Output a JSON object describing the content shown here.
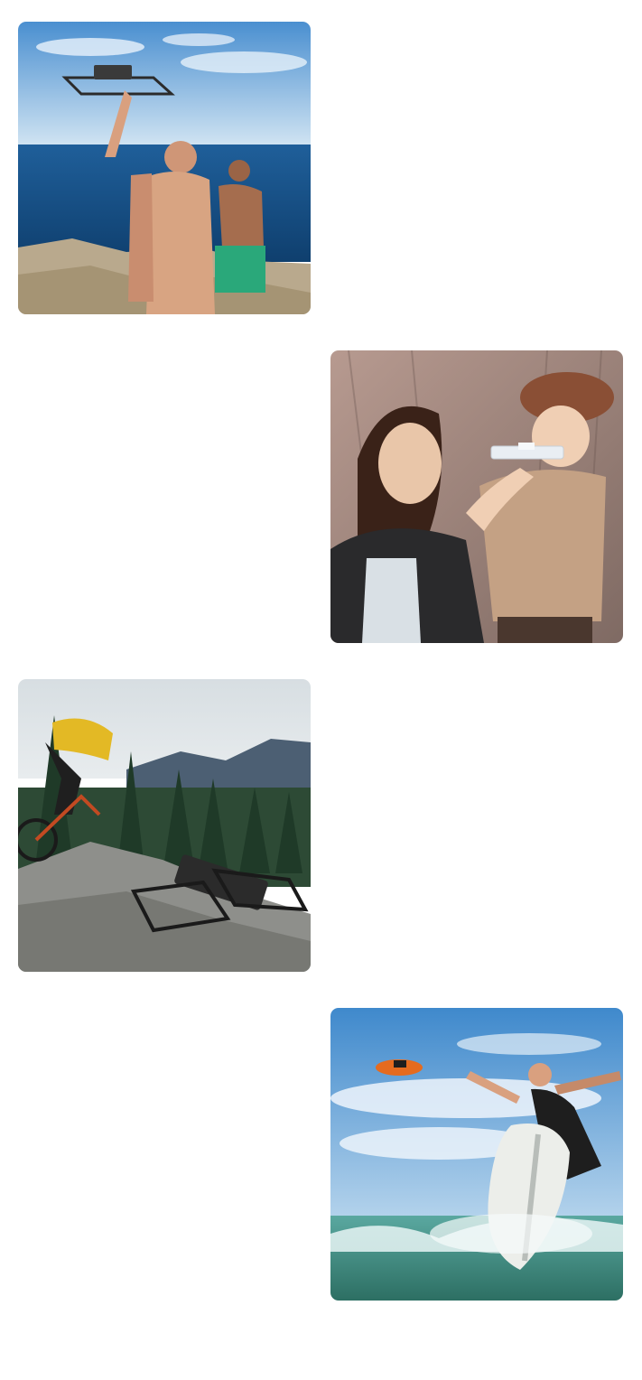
{
  "gallery": {
    "images": [
      {
        "scene": "cliff-seaside-drone-launch",
        "accent": "#2a6fa8"
      },
      {
        "scene": "mother-child-drone",
        "accent": "#8a6f66"
      },
      {
        "scene": "mountain-bike-drone-kit",
        "accent": "#2f5a3d"
      },
      {
        "scene": "surfer-orange-drone",
        "accent": "#3a86c8"
      }
    ]
  }
}
